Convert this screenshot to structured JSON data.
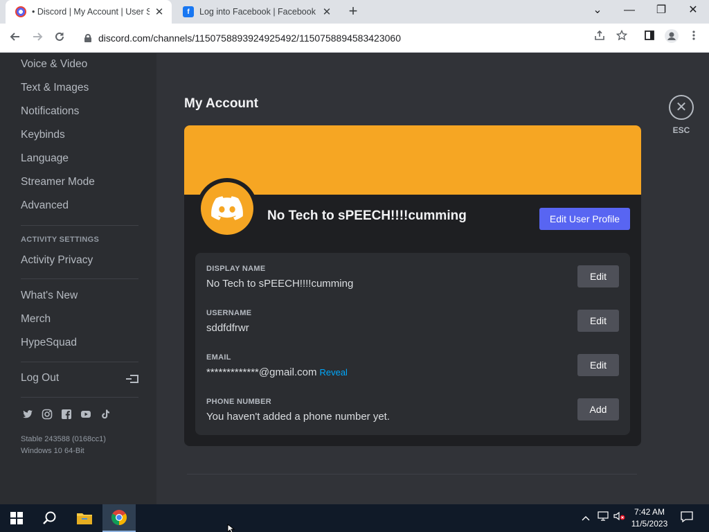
{
  "browser": {
    "tabs": [
      {
        "title": "• Discord | My Account | User Settings",
        "close": "✕"
      },
      {
        "title": "Log into Facebook | Facebook",
        "close": "✕"
      }
    ],
    "new_tab": "+",
    "window": {
      "minimize": "—",
      "maximize": "❐",
      "close": "✕",
      "tabs_menu": "⌄"
    },
    "url": "discord.com/channels/1150758893924925492/1150758894583423060"
  },
  "sidebar": {
    "items_top": [
      "Voice & Video",
      "Text & Images",
      "Notifications",
      "Keybinds",
      "Language",
      "Streamer Mode",
      "Advanced"
    ],
    "activity_header": "ACTIVITY SETTINGS",
    "activity_items": [
      "Activity Privacy"
    ],
    "info_items": [
      "What's New",
      "Merch",
      "HypeSquad"
    ],
    "logout": "Log Out",
    "socials": [
      "twitter-icon",
      "instagram-icon",
      "facebook-icon",
      "youtube-icon",
      "tiktok-icon"
    ],
    "version": "Stable 243588 (0168cc1)",
    "os": "Windows 10 64-Bit"
  },
  "main": {
    "title": "My Account",
    "esc_label": "ESC",
    "profile": {
      "name": "No Tech to sPEECH!!!!cumming",
      "edit_profile": "Edit User Profile",
      "banner_color": "#f6a623",
      "avatar_color": "#f6a623"
    },
    "fields": [
      {
        "label": "DISPLAY NAME",
        "value": "No Tech to sPEECH!!!!cumming",
        "button": "Edit"
      },
      {
        "label": "USERNAME",
        "value": "sddfdfrwr",
        "button": "Edit"
      },
      {
        "label": "EMAIL",
        "value": "*************@gmail.com",
        "extra": "Reveal",
        "button": "Edit"
      },
      {
        "label": "PHONE NUMBER",
        "value": "You haven't added a phone number yet.",
        "button": "Add"
      }
    ]
  },
  "colors": {
    "blurple": "#5865f2",
    "sidebar": "#2b2d31",
    "main": "#313338",
    "card": "#1e1f22"
  },
  "taskbar": {
    "time": "7:42 AM",
    "date": "11/5/2023"
  }
}
